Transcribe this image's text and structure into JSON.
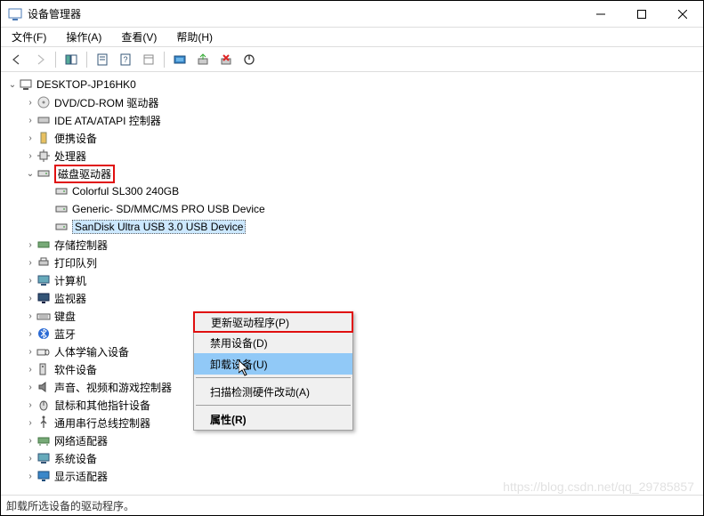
{
  "window": {
    "title": "设备管理器"
  },
  "menubar": {
    "file": "文件(F)",
    "action": "操作(A)",
    "view": "查看(V)",
    "help": "帮助(H)"
  },
  "tree": {
    "root": "DESKTOP-JP16HK0",
    "dvd": "DVD/CD-ROM 驱动器",
    "ide": "IDE ATA/ATAPI 控制器",
    "portable": "便携设备",
    "cpu": "处理器",
    "disk": "磁盘驱动器",
    "disk_children": {
      "c0": "Colorful SL300 240GB",
      "c1": "Generic- SD/MMC/MS PRO USB Device",
      "c2": "SanDisk Ultra USB 3.0 USB Device"
    },
    "storage": "存储控制器",
    "print": "打印队列",
    "computer": "计算机",
    "monitor": "监视器",
    "keyboard": "键盘",
    "bluetooth": "蓝牙",
    "hid": "人体学输入设备",
    "software": "软件设备",
    "audio": "声音、视频和游戏控制器",
    "mouse": "鼠标和其他指针设备",
    "usb": "通用串行总线控制器",
    "network": "网络适配器",
    "system": "系统设备",
    "display": "显示适配器"
  },
  "context_menu": {
    "update": "更新驱动程序(P)",
    "disable": "禁用设备(D)",
    "uninstall": "卸载设备(U)",
    "scan": "扫描检测硬件改动(A)",
    "properties": "属性(R)"
  },
  "statusbar": {
    "text": "卸载所选设备的驱动程序。"
  },
  "watermark": "https://blog.csdn.net/qq_29785857"
}
